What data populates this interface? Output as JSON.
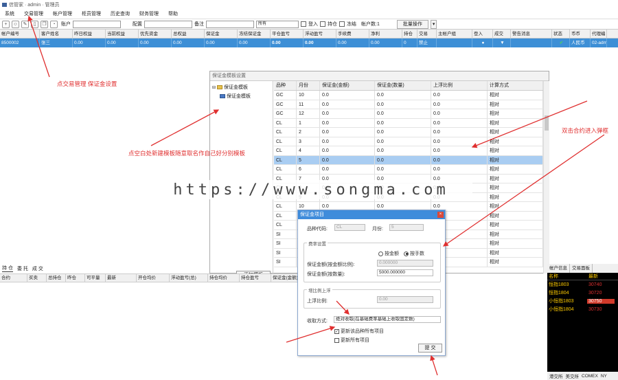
{
  "app": {
    "title": "信管家 · admin · 管理员"
  },
  "menu": [
    "系统",
    "交易管理",
    "帐户管理",
    "柜员管理",
    "历史查询",
    "财务管理",
    "帮助"
  ],
  "toolbar": {
    "account_label": "账户",
    "config_label": "配置",
    "remark_label": "备注",
    "filter_value": "所有",
    "login_label": "登入",
    "position_label": "持仓",
    "close_label": "冻结",
    "account_count": "帐户数:1",
    "batch_label": "批量操作"
  },
  "account_grid": {
    "headers": [
      "帐户编号",
      "客户姓名",
      "昨日权益",
      "当前权益",
      "优先资金",
      "总权益",
      "保证金",
      "冻结保证金",
      "平仓盈亏",
      "浮动盈亏",
      "手续费",
      "净利",
      "持仓",
      "交易",
      "主帐户组",
      "登入",
      "成交",
      "警告消息",
      "状态",
      "币币",
      "代理编"
    ],
    "row": [
      "8500002",
      "张三",
      "0.00",
      "0.00",
      "0.00",
      "0.00",
      "0.00",
      "0.00",
      "0.00",
      "0.00",
      "0.00",
      "0.00",
      "0",
      "禁止",
      "",
      "●",
      "▼",
      "",
      "✔",
      "人民币",
      "02-adm"
    ]
  },
  "margin_panel": {
    "title": "保证金模板设置",
    "tree_root": "保证金模板",
    "tree_child": "保证金模板",
    "add_template": "添加模板",
    "columns": [
      "品种",
      "月份",
      "保证金(金额)",
      "保证金(数量)",
      "上浮比例",
      "计算方式"
    ],
    "rows": [
      [
        "GC",
        "10",
        "0.0",
        "0.0",
        "0.0",
        "相对"
      ],
      [
        "GC",
        "11",
        "0.0",
        "0.0",
        "0.0",
        "相对"
      ],
      [
        "GC",
        "12",
        "0.0",
        "0.0",
        "0.0",
        "相对"
      ],
      [
        "CL",
        "1",
        "0.0",
        "0.0",
        "0.0",
        "相对"
      ],
      [
        "CL",
        "2",
        "0.0",
        "0.0",
        "0.0",
        "相对"
      ],
      [
        "CL",
        "3",
        "0.0",
        "0.0",
        "0.0",
        "相对"
      ],
      [
        "CL",
        "4",
        "0.0",
        "0.0",
        "0.0",
        "相对"
      ],
      [
        "CL",
        "5",
        "0.0",
        "0.0",
        "0.0",
        "相对"
      ],
      [
        "CL",
        "6",
        "0.0",
        "0.0",
        "0.0",
        "相对"
      ],
      [
        "CL",
        "7",
        "0.0",
        "0.0",
        "0.0",
        "相对"
      ],
      [
        "CL",
        "8",
        "0.0",
        "0.0",
        "0.0",
        "相对"
      ],
      [
        "CL",
        "9",
        "0.0",
        "0.0",
        "0.0",
        "相对"
      ],
      [
        "CL",
        "10",
        "0.0",
        "0.0",
        "0.0",
        "相对"
      ],
      [
        "CL",
        "11",
        "0.0",
        "0.0",
        "0.0",
        "相对"
      ],
      [
        "CL",
        "12",
        "0.0",
        "0.0",
        "0.0",
        "相对"
      ],
      [
        "SI",
        "1",
        "0.0",
        "0.0",
        "0.0",
        "相对"
      ],
      [
        "SI",
        "2",
        "0.0",
        "0.0",
        "0.0",
        "相对"
      ],
      [
        "SI",
        "3",
        "0.0",
        "0.0",
        "0.0",
        "相对"
      ],
      [
        "SI",
        "4",
        "0.0",
        "0.0",
        "0.0",
        "相对"
      ]
    ],
    "selected_row": 7
  },
  "dialog": {
    "title": "保证金项目",
    "code_label": "品种代码:",
    "code_value": "CL",
    "month_label": "月份:",
    "month_value": "5",
    "rate_group": "费率设置",
    "by_amount": "按金额",
    "by_hands": "按手数",
    "ratio_label": "保证金额(按金额比例):",
    "ratio_value": "0.000000",
    "per_hand_label": "保证金额(按数量):",
    "per_hand_value": "5000.000000",
    "float_group": "增比例上浮",
    "float_label": "上浮比例:",
    "float_value": "0.00",
    "method_label": "收取方式:",
    "method_value": "绝对收取(在基础费率基础上收取固定数)",
    "check1": "更新该品种所有项目",
    "check2": "更新所有项目",
    "submit": "提 交"
  },
  "bottom": {
    "tabs": [
      "持 仓",
      "委 托",
      "成 交"
    ],
    "headers": [
      "合约",
      "买卖",
      "总持仓",
      "昨仓",
      "可平量",
      "最新",
      "开仓均价",
      "浮动盈亏(总)",
      "持仓均价",
      "持仓盈亏",
      "保证金(金额)"
    ]
  },
  "quotes": {
    "tabs": [
      "帐户信息",
      "交易面板"
    ],
    "head": [
      "名称",
      "最新"
    ],
    "rows": [
      {
        "name": "恒指1803",
        "value": "30740",
        "hl": false
      },
      {
        "name": "恒指1804",
        "value": "30720",
        "hl": false
      },
      {
        "name": "小恒指1803",
        "value": "30750",
        "hl": true
      },
      {
        "name": "小恒指1804",
        "value": "30730",
        "hl": false
      }
    ],
    "exchanges": [
      "港交所",
      "美交所",
      "COMEX",
      "NY"
    ]
  },
  "annotations": {
    "a1": "点交易管理  保证金设置",
    "a2": "点空白处新建模板随意取名作自己好分别模板",
    "a3": "双击合约进入弹框"
  },
  "watermark": "https://www.songma.com"
}
